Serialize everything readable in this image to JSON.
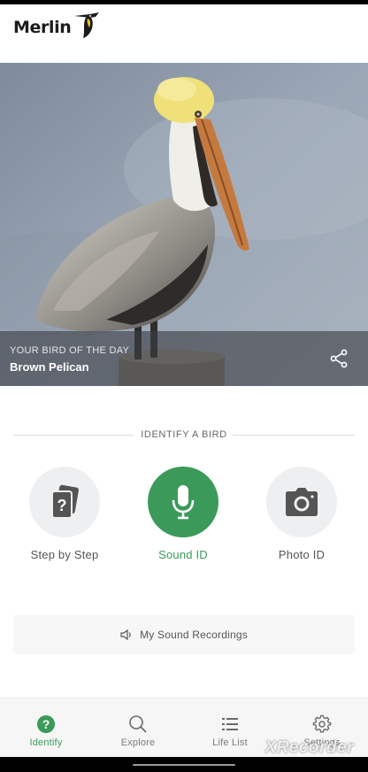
{
  "app": {
    "logo_text": "Merlin"
  },
  "hero": {
    "kicker": "YOUR BIRD OF THE DAY",
    "bird_name": "Brown Pelican",
    "share_icon": "share-icon"
  },
  "identify": {
    "title": "IDENTIFY A BIRD",
    "options": [
      {
        "label": "Step by Step",
        "icon": "question-cards-icon",
        "active": false
      },
      {
        "label": "Sound ID",
        "icon": "microphone-icon",
        "active": true
      },
      {
        "label": "Photo ID",
        "icon": "camera-icon",
        "active": false
      }
    ]
  },
  "recordings": {
    "label": "My Sound Recordings",
    "icon": "speaker-icon"
  },
  "nav": {
    "items": [
      {
        "label": "Identify",
        "icon": "help-circle-icon",
        "active": true
      },
      {
        "label": "Explore",
        "icon": "search-icon",
        "active": false
      },
      {
        "label": "Life List",
        "icon": "list-icon",
        "active": false
      },
      {
        "label": "Settings",
        "icon": "gear-icon",
        "active": false
      }
    ]
  },
  "watermark": "XRecorder",
  "colors": {
    "accent": "#3b9a5a",
    "icon_gray": "#545454",
    "caption_bg": "#3c3e44"
  }
}
